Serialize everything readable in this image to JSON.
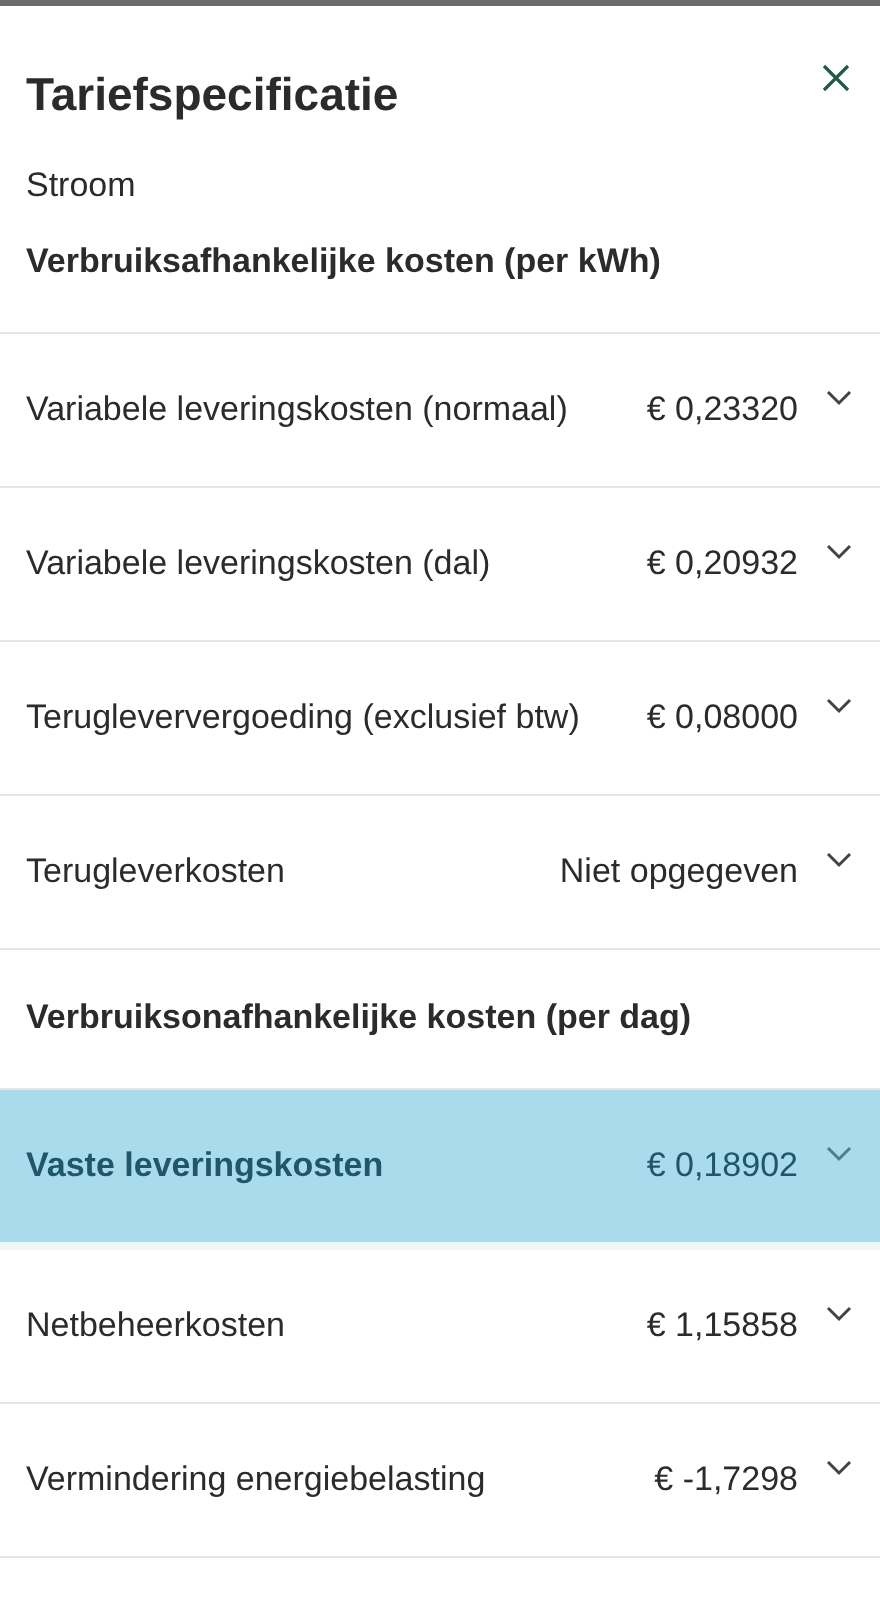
{
  "title": "Tariefspecificatie",
  "subtitle": "Stroom",
  "sections": [
    {
      "heading": "Verbruiksafhankelijke kosten (per kWh)",
      "rows": [
        {
          "label": "Variabele leveringskosten (normaal)",
          "value": "€ 0,23320",
          "selected": false
        },
        {
          "label": "Variabele leveringskosten (dal)",
          "value": "€ 0,20932",
          "selected": false
        },
        {
          "label": "Terugleververgoeding (exclusief btw)",
          "value": "€ 0,08000",
          "selected": false
        },
        {
          "label": "Terugleverkosten",
          "value": "Niet opgegeven",
          "selected": false
        }
      ]
    },
    {
      "heading": "Verbruiksonafhankelijke kosten (per dag)",
      "rows": [
        {
          "label": "Vaste leveringskosten",
          "value": "€ 0,18902",
          "selected": true
        },
        {
          "label": "Netbeheerkosten",
          "value": "€ 1,15858",
          "selected": false
        },
        {
          "label": "Vermindering energiebelasting",
          "value": "€ -1,7298",
          "selected": false
        }
      ]
    }
  ]
}
